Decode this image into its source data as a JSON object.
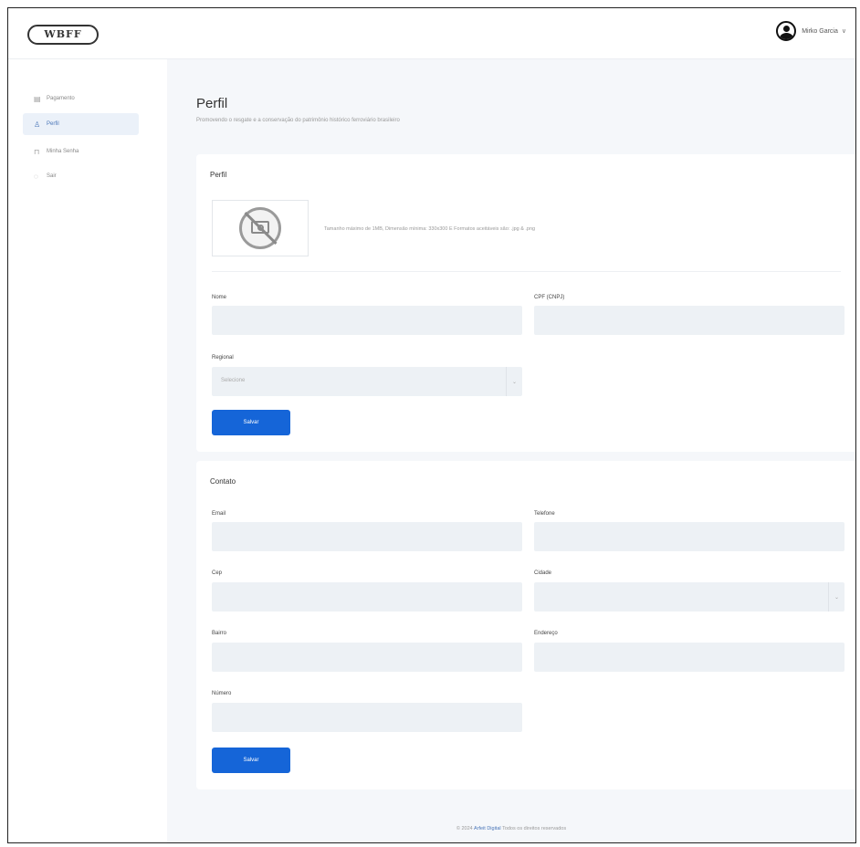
{
  "header": {
    "logo_text": "WBFF",
    "user_name": "Mirko Garcia",
    "chevron": "∨"
  },
  "sidebar": {
    "items": [
      {
        "label": "Pagamento",
        "icon": "document-icon",
        "active": false
      },
      {
        "label": "Perfil",
        "icon": "user-icon",
        "active": true
      },
      {
        "label": "Minha Senha",
        "icon": "lock-icon",
        "active": false
      },
      {
        "label": "Sair",
        "icon": "logout-icon",
        "active": false
      }
    ]
  },
  "page": {
    "title": "Perfil",
    "subtitle": "Promovendo o resgate e a conservação do patrimônio histórico ferroviário brasileiro"
  },
  "profile_card": {
    "title": "Perfil",
    "photo_hint": "Tamanho máximo de 1MB, Dimensão mínima: 330x300 E Formatos aceitáveis são: .jpg & .png",
    "name_label": "Nome",
    "name_value": "",
    "cpf_label": "CPF (CNPJ)",
    "cpf_value": "",
    "regional_label": "Regional",
    "regional_value": "Selecione",
    "save_label": "Salvar"
  },
  "contact_card": {
    "title": "Contato",
    "email_label": "Email",
    "phone_label": "Telefone",
    "cep_label": "Cep",
    "city_label": "Cidade",
    "district_label": "Bairro",
    "address_label": "Endereço",
    "number_label": "Número",
    "save_label": "Salvar"
  },
  "footer": {
    "prefix": "© 2024",
    "brand": "Arfeit Digital",
    "suffix": "Todos os direitos reservados"
  }
}
